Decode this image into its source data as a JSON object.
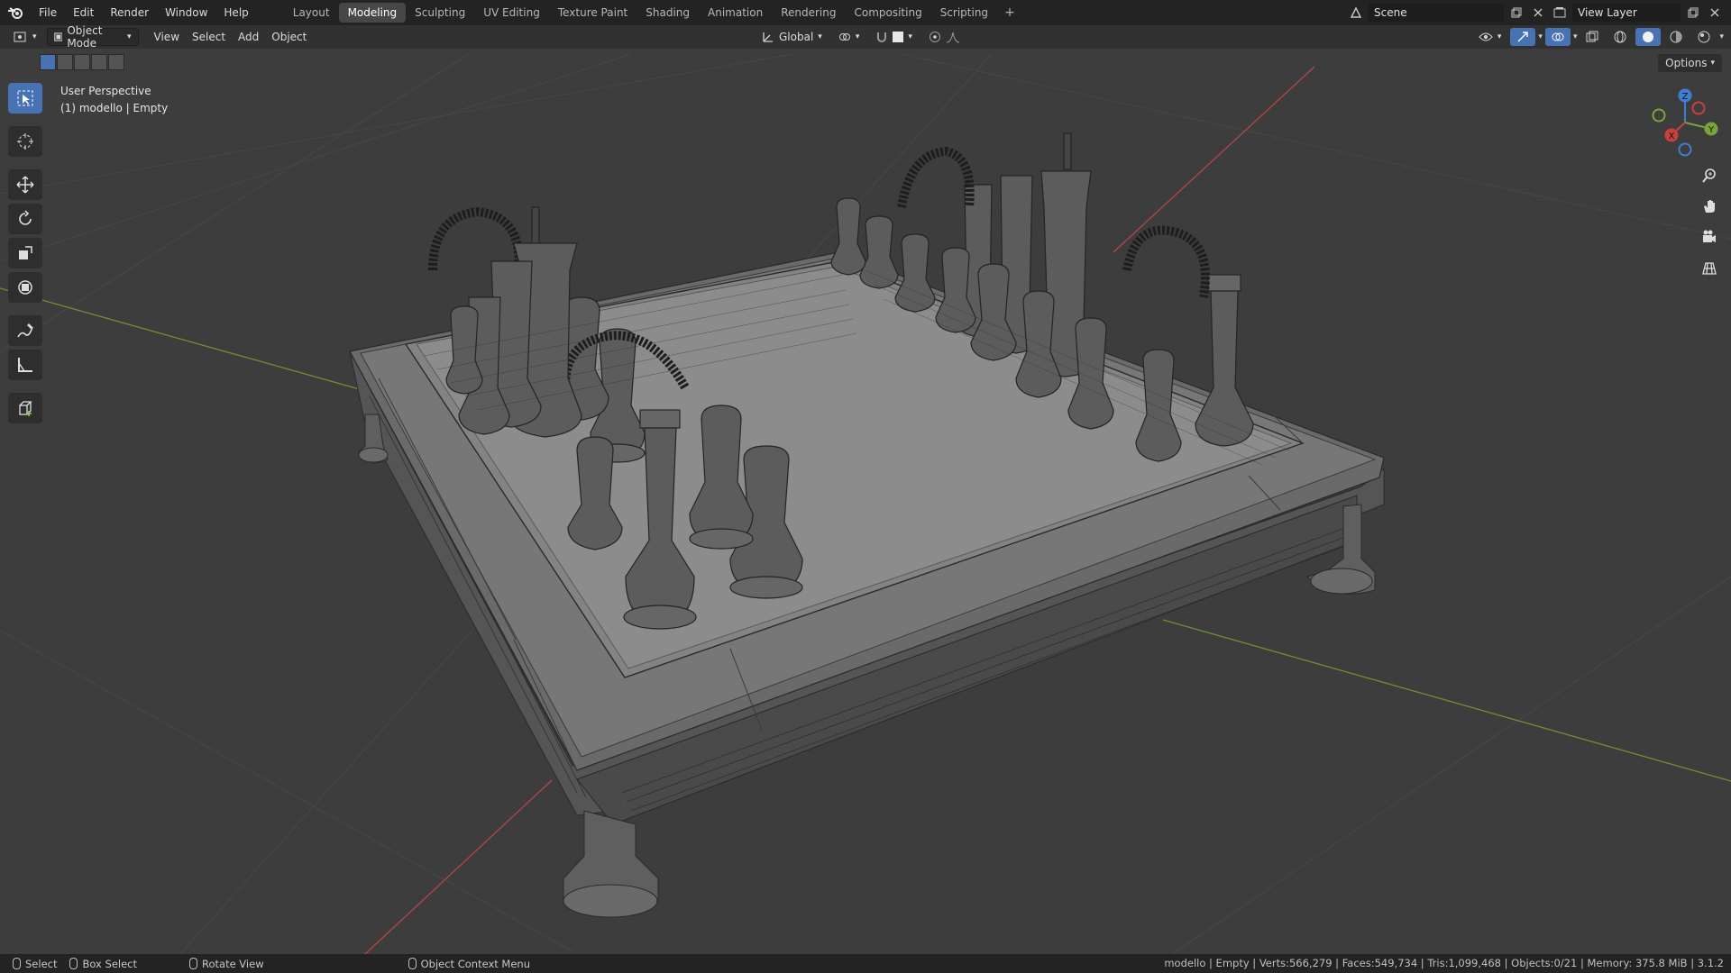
{
  "topbar": {
    "menus": [
      "File",
      "Edit",
      "Render",
      "Window",
      "Help"
    ],
    "workspaces": [
      "Layout",
      "Modeling",
      "Sculpting",
      "UV Editing",
      "Texture Paint",
      "Shading",
      "Animation",
      "Rendering",
      "Compositing",
      "Scripting"
    ],
    "active_workspace": "Modeling",
    "add_tab": "+",
    "scene_name": "Scene",
    "view_layer": "View Layer"
  },
  "header": {
    "mode": "Object Mode",
    "menus": [
      "View",
      "Select",
      "Add",
      "Object"
    ],
    "orientation": "Global",
    "options": "Options"
  },
  "viewport": {
    "view_name": "User Perspective",
    "object_info": "(1) modello | Empty",
    "gizmo_axes": {
      "x": "X",
      "y": "Y",
      "z": "Z"
    },
    "colors": {
      "x_axis": "#c94040",
      "y_axis": "#7aa33a",
      "z_axis": "#3f7ed6",
      "background": "#3d3d3d",
      "accent": "#4772b3"
    }
  },
  "toolbar": {
    "tools": [
      "select-box-icon",
      "cursor-icon",
      "move-icon",
      "rotate-icon",
      "scale-icon",
      "transform-icon",
      "annotate-icon",
      "measure-icon",
      "add-cube-icon"
    ],
    "active": "select-box-icon"
  },
  "navigation": [
    "zoom-icon",
    "pan-hand-icon",
    "camera-icon",
    "ortho-grid-icon"
  ],
  "statusbar": {
    "select": "Select",
    "box_select": "Box Select",
    "rotate_view": "Rotate View",
    "context_menu": "Object Context Menu",
    "stats": "modello | Empty | Verts:566,279 | Faces:549,734 | Tris:1,099,468 | Objects:0/21 | Memory: 375.8 MiB | 3.1.2"
  }
}
